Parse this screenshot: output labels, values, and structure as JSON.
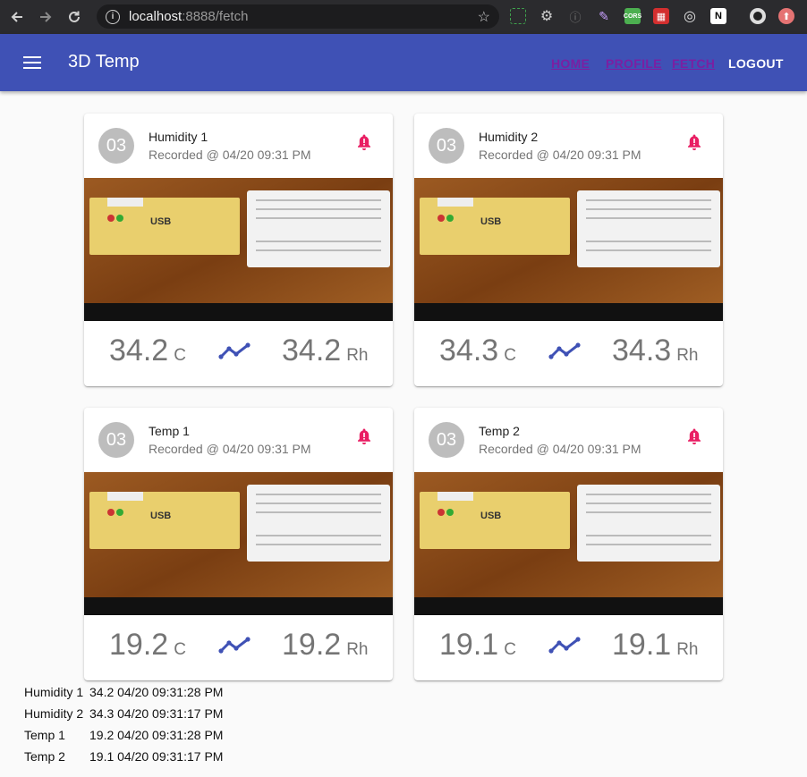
{
  "browser": {
    "url_host": "localhost",
    "url_path": ":8888/fetch"
  },
  "appbar": {
    "title": "3D Temp",
    "nav": [
      "HOME",
      "PROFILE",
      "FETCH",
      "LOGOUT"
    ]
  },
  "cards": [
    {
      "avatar": "03",
      "title": "Humidity 1",
      "subtitle": "Recorded @ 04/20 09:31 PM",
      "temp": "34.2",
      "temp_unit": "C",
      "hum": "34.2",
      "hum_unit": "Rh"
    },
    {
      "avatar": "03",
      "title": "Humidity 2",
      "subtitle": "Recorded @ 04/20 09:31 PM",
      "temp": "34.3",
      "temp_unit": "C",
      "hum": "34.3",
      "hum_unit": "Rh"
    },
    {
      "avatar": "03",
      "title": "Temp 1",
      "subtitle": "Recorded @ 04/20 09:31 PM",
      "temp": "19.2",
      "temp_unit": "C",
      "hum": "19.2",
      "hum_unit": "Rh"
    },
    {
      "avatar": "03",
      "title": "Temp 2",
      "subtitle": "Recorded @ 04/20 09:31 PM",
      "temp": "19.1",
      "temp_unit": "C",
      "hum": "19.1",
      "hum_unit": "Rh"
    }
  ],
  "log": [
    {
      "name": "Humidity 1",
      "value": "34.2 04/20 09:31:28 PM"
    },
    {
      "name": "Humidity 2",
      "value": "34.3 04/20 09:31:17 PM"
    },
    {
      "name": "Temp 1",
      "value": "19.2 04/20 09:31:28 PM"
    },
    {
      "name": "Temp 2",
      "value": "19.1 04/20 09:31:17 PM"
    }
  ],
  "colors": {
    "appbar": "#3f51b5",
    "bell": "#e91e63",
    "trend": "#3f51b5"
  }
}
